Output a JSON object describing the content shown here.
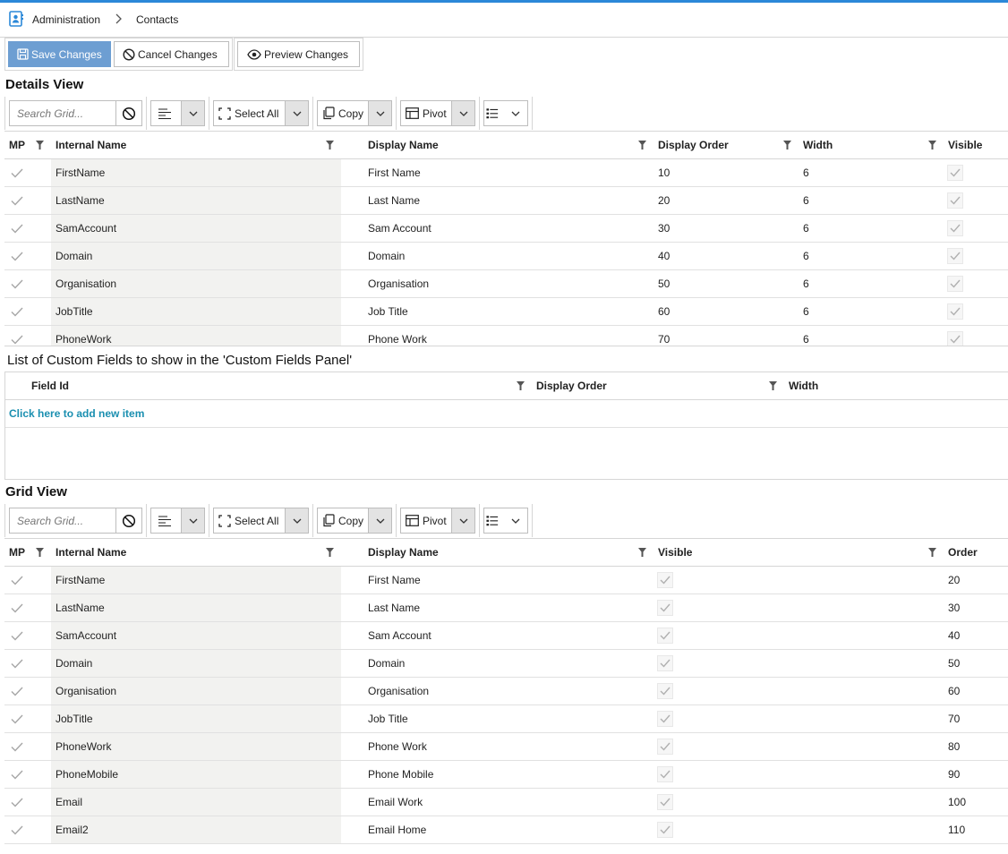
{
  "breadcrumb": {
    "items": [
      "Administration",
      "Contacts"
    ],
    "icon": "contacts-icon"
  },
  "actions": {
    "save": "Save Changes",
    "cancel": "Cancel Changes",
    "preview": "Preview Changes"
  },
  "toolbar": {
    "search_placeholder": "Search Grid...",
    "select_all": "Select All",
    "copy": "Copy",
    "pivot": "Pivot"
  },
  "details": {
    "title": "Details View",
    "columns": [
      "MP",
      "Internal Name",
      "Display Name",
      "Display Order",
      "Width",
      "Visible"
    ],
    "rows": [
      {
        "internal": "FirstName",
        "display": "First Name",
        "order": "10",
        "width": "6"
      },
      {
        "internal": "LastName",
        "display": "Last Name",
        "order": "20",
        "width": "6"
      },
      {
        "internal": "SamAccount",
        "display": "Sam Account",
        "order": "30",
        "width": "6"
      },
      {
        "internal": "Domain",
        "display": "Domain",
        "order": "40",
        "width": "6"
      },
      {
        "internal": "Organisation",
        "display": "Organisation",
        "order": "50",
        "width": "6"
      },
      {
        "internal": "JobTitle",
        "display": "Job Title",
        "order": "60",
        "width": "6"
      },
      {
        "internal": "PhoneWork",
        "display": "Phone Work",
        "order": "70",
        "width": "6"
      }
    ]
  },
  "custom": {
    "title": "List of Custom Fields to show in the 'Custom Fields Panel'",
    "columns": [
      "Field Id",
      "Display Order",
      "Width"
    ],
    "add_link": "Click here to add new item"
  },
  "gridview": {
    "title": "Grid View",
    "columns": [
      "MP",
      "Internal Name",
      "Display Name",
      "Visible",
      "Order"
    ],
    "rows": [
      {
        "internal": "FirstName",
        "display": "First Name",
        "order": "20"
      },
      {
        "internal": "LastName",
        "display": "Last Name",
        "order": "30"
      },
      {
        "internal": "SamAccount",
        "display": "Sam Account",
        "order": "40"
      },
      {
        "internal": "Domain",
        "display": "Domain",
        "order": "50"
      },
      {
        "internal": "Organisation",
        "display": "Organisation",
        "order": "60"
      },
      {
        "internal": "JobTitle",
        "display": "Job Title",
        "order": "70"
      },
      {
        "internal": "PhoneWork",
        "display": "Phone Work",
        "order": "80"
      },
      {
        "internal": "PhoneMobile",
        "display": "Phone Mobile",
        "order": "90"
      },
      {
        "internal": "Email",
        "display": "Email Work",
        "order": "100"
      },
      {
        "internal": "Email2",
        "display": "Email Home",
        "order": "110"
      }
    ]
  },
  "colors": {
    "accent": "#2b88d8",
    "primary_button": "#6d9ed2",
    "link": "#1a8fb0",
    "shade": "#f2f2f0"
  }
}
